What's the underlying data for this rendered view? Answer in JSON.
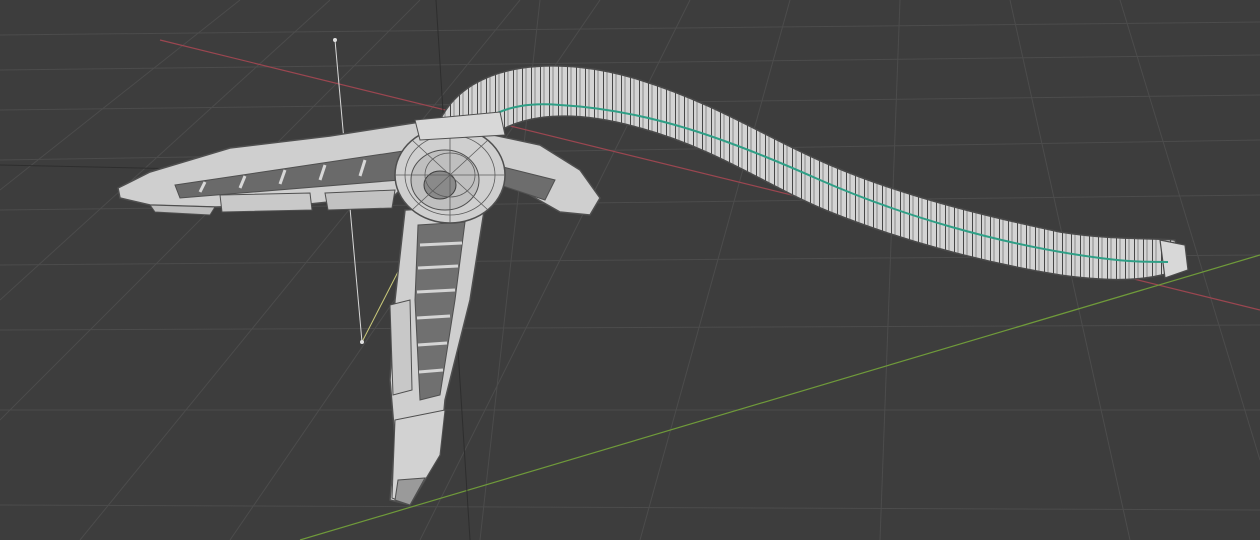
{
  "viewport": {
    "background": "#3d3d3d",
    "grid_color": "#4a4a4a",
    "axis_x_color": "#9b4650",
    "axis_y_color": "#6f9a3a"
  },
  "model": {
    "mesh_color": "#cfcfcf",
    "edge_color": "#5a5a5a",
    "curve_color": "#2f9f86"
  },
  "objects": [
    {
      "name": "empty-axis-line-icon",
      "role": "reference line"
    },
    {
      "name": "spine-curve-icon",
      "role": "curve"
    },
    {
      "name": "left-wing-mesh-icon",
      "role": "mesh"
    },
    {
      "name": "lower-limb-mesh-icon",
      "role": "mesh"
    },
    {
      "name": "hub-mesh-icon",
      "role": "mesh"
    },
    {
      "name": "tail-mesh-icon",
      "role": "mesh"
    }
  ]
}
